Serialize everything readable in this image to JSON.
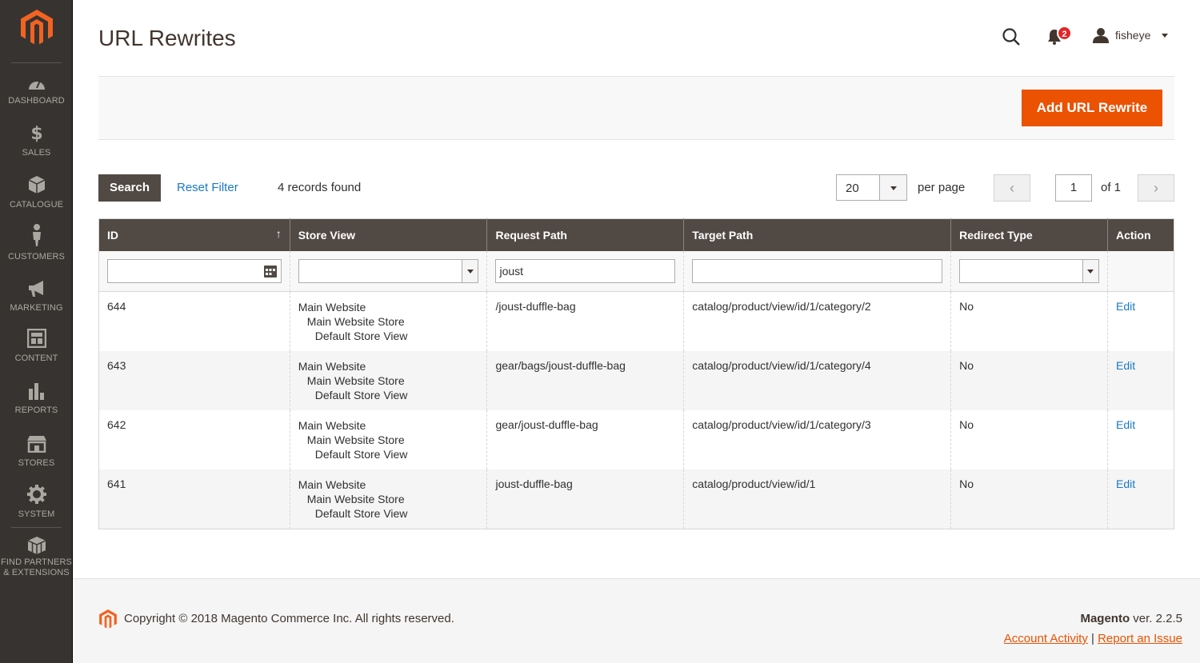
{
  "page": {
    "title": "URL Rewrites"
  },
  "header": {
    "notifications_count": "2",
    "username": "fisheye"
  },
  "sidebar": {
    "items": [
      {
        "label": "DASHBOARD",
        "icon": "dashboard-icon"
      },
      {
        "label": "SALES",
        "icon": "dollar-icon"
      },
      {
        "label": "CATALOGUE",
        "icon": "cube-icon"
      },
      {
        "label": "CUSTOMERS",
        "icon": "person-icon"
      },
      {
        "label": "MARKETING",
        "icon": "megaphone-icon"
      },
      {
        "label": "CONTENT",
        "icon": "layout-icon"
      },
      {
        "label": "REPORTS",
        "icon": "bar-chart-icon"
      },
      {
        "label": "STORES",
        "icon": "store-icon"
      },
      {
        "label": "SYSTEM",
        "icon": "gear-icon"
      }
    ],
    "partners_line1": "FIND PARTNERS",
    "partners_line2": "& EXTENSIONS"
  },
  "actions": {
    "add_label": "Add URL Rewrite"
  },
  "toolbar": {
    "search_label": "Search",
    "reset_label": "Reset Filter",
    "records_found": "4 records found",
    "per_page_value": "20",
    "per_page_label": "per page",
    "page_value": "1",
    "of_label": "of 1"
  },
  "grid": {
    "columns": [
      "ID",
      "Store View",
      "Request Path",
      "Target Path",
      "Redirect Type",
      "Action"
    ],
    "filter_request_path": "joust",
    "rows": [
      {
        "id": "644",
        "website": "Main Website",
        "store": "Main Website Store",
        "view": "Default Store View",
        "request": "/joust-duffle-bag",
        "target": "catalog/product/view/id/1/category/2",
        "redirect": "No",
        "action": "Edit"
      },
      {
        "id": "643",
        "website": "Main Website",
        "store": "Main Website Store",
        "view": "Default Store View",
        "request": "gear/bags/joust-duffle-bag",
        "target": "catalog/product/view/id/1/category/4",
        "redirect": "No",
        "action": "Edit"
      },
      {
        "id": "642",
        "website": "Main Website",
        "store": "Main Website Store",
        "view": "Default Store View",
        "request": "gear/joust-duffle-bag",
        "target": "catalog/product/view/id/1/category/3",
        "redirect": "No",
        "action": "Edit"
      },
      {
        "id": "641",
        "website": "Main Website",
        "store": "Main Website Store",
        "view": "Default Store View",
        "request": "joust-duffle-bag",
        "target": "catalog/product/view/id/1",
        "redirect": "No",
        "action": "Edit"
      }
    ]
  },
  "footer": {
    "copyright": "Copyright © 2018 Magento Commerce Inc. All rights reserved.",
    "version_brand": "Magento",
    "version_text": " ver. 2.2.5",
    "account_activity": "Account Activity",
    "separator": "|",
    "report_issue": "Report an Issue"
  },
  "colors": {
    "accent": "#eb5202",
    "sidebar": "#373330",
    "header": "#514943",
    "link": "#1979c3"
  }
}
